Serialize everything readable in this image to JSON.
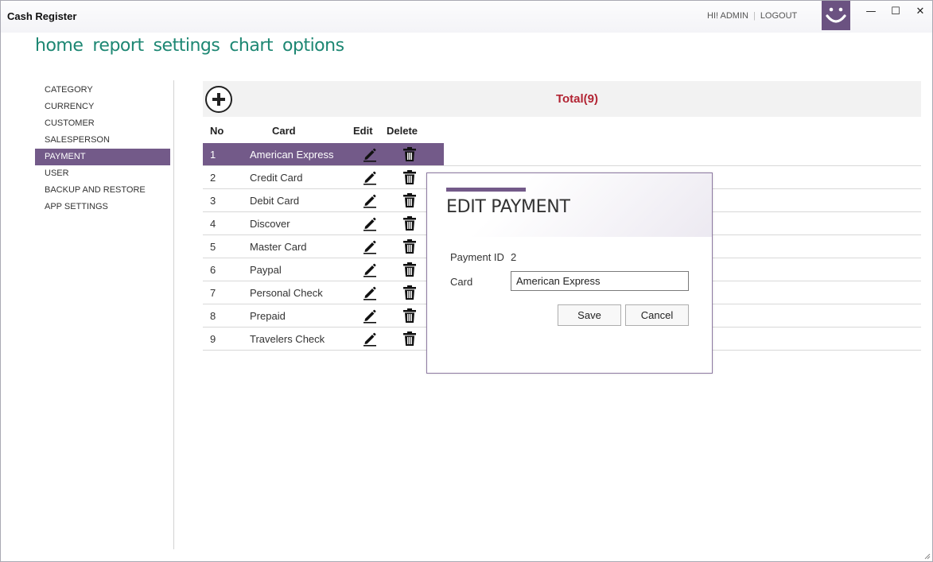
{
  "window": {
    "title": "Cash Register",
    "greeting": "HI! ADMIN",
    "logout": "LOGOUT",
    "minimize": "—",
    "maximize": "☐",
    "close": "✕"
  },
  "nav": [
    "home",
    "report",
    "settings",
    "chart",
    "options"
  ],
  "sidebar": {
    "items": [
      {
        "label": "CATEGORY",
        "active": false
      },
      {
        "label": "CURRENCY",
        "active": false
      },
      {
        "label": "CUSTOMER",
        "active": false
      },
      {
        "label": "SALESPERSON",
        "active": false
      },
      {
        "label": "PAYMENT",
        "active": true
      },
      {
        "label": "USER",
        "active": false
      },
      {
        "label": "BACKUP AND RESTORE",
        "active": false
      },
      {
        "label": "APP SETTINGS",
        "active": false
      }
    ]
  },
  "content": {
    "total_label": "Total(9)",
    "columns": {
      "no": "No",
      "card": "Card",
      "edit": "Edit",
      "delete": "Delete"
    },
    "rows": [
      {
        "no": "1",
        "card": "American Express"
      },
      {
        "no": "2",
        "card": "Credit Card"
      },
      {
        "no": "3",
        "card": "Debit Card"
      },
      {
        "no": "4",
        "card": "Discover"
      },
      {
        "no": "5",
        "card": "Master Card"
      },
      {
        "no": "6",
        "card": "Paypal"
      },
      {
        "no": "7",
        "card": "Personal Check"
      },
      {
        "no": "8",
        "card": "Prepaid"
      },
      {
        "no": "9",
        "card": "Travelers Check"
      }
    ],
    "selected_row": 0
  },
  "modal": {
    "title": "EDIT PAYMENT",
    "payment_id_label": "Payment ID",
    "payment_id_value": "2",
    "card_label": "Card",
    "card_value": "American Express",
    "save": "Save",
    "cancel": "Cancel"
  },
  "colors": {
    "accent": "#735a89",
    "nav": "#1d8773",
    "total": "#b22433"
  },
  "icons": {
    "add": "plus-circle-icon",
    "edit": "pencil-icon",
    "delete": "trash-icon",
    "logo": "smiley-icon"
  }
}
